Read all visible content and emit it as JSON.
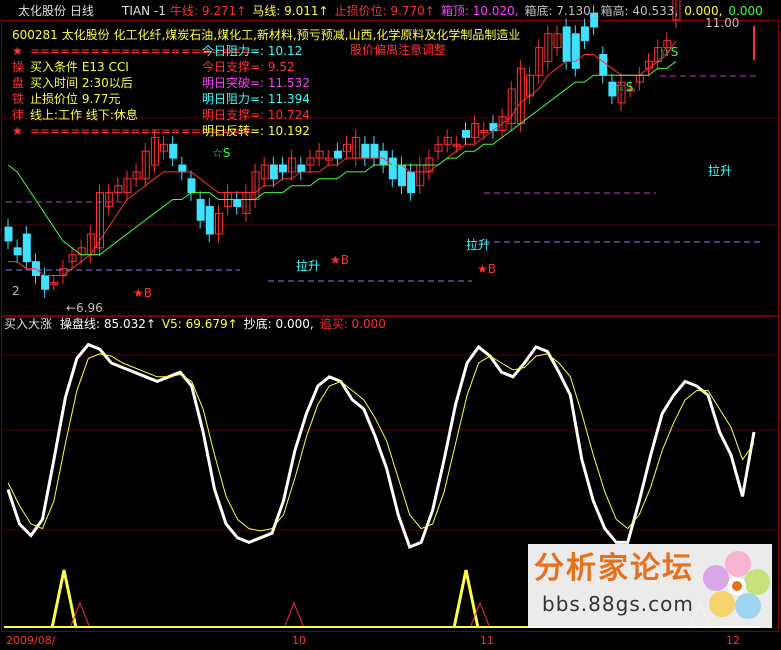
{
  "header": {
    "title": "太化股份 日线",
    "formula": "TIAN -1",
    "items": [
      {
        "label": "牛线:",
        "value": "9.271↑",
        "color": "#ff3030"
      },
      {
        "label": "马线:",
        "value": "9.011↑",
        "color": "#ffff40"
      },
      {
        "label": "止损价位:",
        "value": "9.770↑",
        "color": "#ff3030"
      },
      {
        "label": "箱顶:",
        "value": "10.020,",
        "color": "#ff40ff"
      },
      {
        "label": "箱底:",
        "value": "7.130,",
        "color": "#c0c0c0"
      },
      {
        "label": "箱高:",
        "value": "40.533,",
        "color": "#c0c0c0"
      },
      {
        "label": "",
        "value": "0.000,",
        "color": "#ffff40"
      },
      {
        "label": "",
        "value": "0.000",
        "color": "#40ff40"
      }
    ],
    "price_top": "11.00"
  },
  "info": {
    "stock_line": "600281 太化股份  化工化纤,煤炭石油,煤化工,新材料,预亏预减,山西,化学原料及化学制品制造业",
    "warning": "股价偏离注意调整",
    "rows_left": [
      {
        "mark": "★",
        "text": "======================"
      },
      {
        "mark": "操",
        "text": "买入条件     E13 CCI"
      },
      {
        "mark": "盘",
        "text": "买入时间     2:30以后"
      },
      {
        "mark": "铁",
        "text": "止损价位     9.77元"
      },
      {
        "mark": "律",
        "text": "线上:工作    线下:休息"
      },
      {
        "mark": "★",
        "text": "======================"
      }
    ],
    "rows_right": [
      {
        "text": "今日阻力=: 10.12",
        "color": "#40ffff"
      },
      {
        "text": "今日支撑=: 9.52",
        "color": "#ff3030"
      },
      {
        "text": "明日突破=: 11.532",
        "color": "#ff40ff"
      },
      {
        "text": "明日阻力=: 11.394",
        "color": "#40ffff"
      },
      {
        "text": "明日支撑=: 10.724",
        "color": "#ff3030"
      },
      {
        "text": "明日反转=: 10.192",
        "color": "#ffff40"
      }
    ]
  },
  "annotations": {
    "s1": "☆S",
    "s2": "☆S",
    "s3": "☆S",
    "b1": "★B",
    "b2": "★B",
    "b3": "★B",
    "l1": "拉升",
    "l2": "拉升",
    "l3": "拉升",
    "low": "←6.96",
    "two": "2"
  },
  "lower_header": {
    "title": "买入大涨",
    "items": [
      {
        "label": "操盘线:",
        "value": "85.032↑",
        "color": "#ffffff"
      },
      {
        "label": "V5:",
        "value": "69.679↑",
        "color": "#ffff40"
      },
      {
        "label": "抄底:",
        "value": "0.000,",
        "color": "#ffffff"
      },
      {
        "label": "追买:",
        "value": "0.000",
        "color": "#ff3030"
      }
    ]
  },
  "x_axis": {
    "labels": [
      "2009/08/",
      "10",
      "11",
      "12"
    ]
  },
  "watermark": {
    "title": "分析家论坛",
    "url": "bbs.88gs.com"
  },
  "colors": {
    "up": "#ff3030",
    "down": "#40e0ff",
    "ma1": "#ff3030",
    "ma2": "#40ff40",
    "osc": "#ffffff",
    "v5": "#ffff40"
  },
  "chart_data": [
    {
      "type": "candlestick",
      "x": [
        1,
        2,
        3,
        4,
        5,
        6,
        7,
        8,
        9,
        10,
        11,
        12,
        13,
        14,
        15,
        16,
        17,
        18,
        19,
        20,
        21,
        22,
        23,
        24,
        25,
        26,
        27,
        28,
        29,
        30,
        31,
        32,
        33,
        34,
        35,
        36,
        37,
        38,
        39,
        40,
        41,
        42,
        43,
        44,
        45,
        46,
        47,
        48,
        49,
        50,
        51,
        52,
        53,
        54,
        55,
        56,
        57,
        58,
        59,
        60,
        61,
        62,
        63,
        64,
        65,
        66,
        67,
        68,
        69,
        70,
        71,
        72,
        73,
        74,
        75,
        76,
        77,
        78,
        79,
        80,
        81
      ],
      "open": [
        8.0,
        7.7,
        7.9,
        7.5,
        7.3,
        7.2,
        7.3,
        7.5,
        7.6,
        7.6,
        7.7,
        8.3,
        8.5,
        8.5,
        8.7,
        8.7,
        8.9,
        9.1,
        9.2,
        8.9,
        8.7,
        8.4,
        8.3,
        7.9,
        8.3,
        8.4,
        8.2,
        8.4,
        8.7,
        8.9,
        8.9,
        8.8,
        8.9,
        8.9,
        9.0,
        9.0,
        9.1,
        9.1,
        9.0,
        9.2,
        9.2,
        9.1,
        9.0,
        8.9,
        8.8,
        8.6,
        8.8,
        9.1,
        9.2,
        9.2,
        9.4,
        9.3,
        9.4,
        9.5,
        9.4,
        9.5,
        9.5,
        9.9,
        10.2,
        10.4,
        10.6,
        10.9,
        10.8,
        10.9,
        11.1,
        10.5,
        10.1,
        9.8,
        10.0,
        10.1,
        10.3,
        10.4,
        10.6,
        11.0
      ],
      "close": [
        7.8,
        7.6,
        7.5,
        7.3,
        7.1,
        7.2,
        7.4,
        7.6,
        7.7,
        7.9,
        8.5,
        8.5,
        8.6,
        8.7,
        8.8,
        9.1,
        9.3,
        9.2,
        9.0,
        8.8,
        8.5,
        8.1,
        7.9,
        8.2,
        8.5,
        8.3,
        8.5,
        8.8,
        8.9,
        8.7,
        8.8,
        9.0,
        8.8,
        9.0,
        9.1,
        9.0,
        9.0,
        9.2,
        9.3,
        9.0,
        9.0,
        8.9,
        8.7,
        8.6,
        8.5,
        8.9,
        9.0,
        9.2,
        9.3,
        9.2,
        9.3,
        9.5,
        9.4,
        9.4,
        9.6,
        10.0,
        10.3,
        10.2,
        10.6,
        10.8,
        10.8,
        10.4,
        10.3,
        10.7,
        10.9,
        10.2,
        9.9,
        10.1,
        10.0,
        10.2,
        10.4,
        10.6,
        10.7,
        11.5
      ],
      "ma_red": [
        7.5,
        7.5,
        7.4,
        7.4,
        7.3,
        7.3,
        7.3,
        7.4,
        7.5,
        7.6,
        7.8,
        8.0,
        8.2,
        8.4,
        8.5,
        8.6,
        8.7,
        8.8,
        8.8,
        8.8,
        8.8,
        8.7,
        8.6,
        8.5,
        8.5,
        8.5,
        8.5,
        8.5,
        8.6,
        8.6,
        8.7,
        8.7,
        8.8,
        8.8,
        8.8,
        8.9,
        8.9,
        9.0,
        9.0,
        9.0,
        9.0,
        9.0,
        8.9,
        8.9,
        8.8,
        8.8,
        8.8,
        8.9,
        9.0,
        9.1,
        9.2,
        9.2,
        9.3,
        9.4,
        9.5,
        9.6,
        9.8,
        9.9,
        10.0,
        10.2,
        10.3,
        10.4,
        10.4,
        10.5,
        10.5,
        10.4,
        10.3,
        10.2,
        10.2,
        10.2,
        10.3,
        10.4,
        10.5,
        10.7
      ],
      "ma_green": [
        8.9,
        8.8,
        8.6,
        8.4,
        8.2,
        8.0,
        7.8,
        7.7,
        7.6,
        7.6,
        7.6,
        7.7,
        7.8,
        7.9,
        8.0,
        8.1,
        8.2,
        8.3,
        8.4,
        8.4,
        8.5,
        8.5,
        8.5,
        8.4,
        8.4,
        8.4,
        8.4,
        8.4,
        8.5,
        8.5,
        8.5,
        8.6,
        8.6,
        8.6,
        8.7,
        8.7,
        8.7,
        8.8,
        8.8,
        8.8,
        8.9,
        8.9,
        8.9,
        8.9,
        8.9,
        8.9,
        8.9,
        8.9,
        9.0,
        9.0,
        9.1,
        9.1,
        9.2,
        9.2,
        9.3,
        9.4,
        9.5,
        9.6,
        9.7,
        9.8,
        9.9,
        10.0,
        10.1,
        10.1,
        10.2,
        10.2,
        10.2,
        10.2,
        10.2,
        10.2,
        10.2,
        10.3,
        10.3,
        10.4
      ],
      "ylim": [
        6.8,
        11.0
      ]
    },
    {
      "type": "line",
      "series": [
        {
          "name": "操盘线",
          "values": [
            35,
            20,
            15,
            22,
            48,
            75,
            92,
            98,
            96,
            90,
            88,
            86,
            84,
            82,
            84,
            86,
            80,
            60,
            35,
            20,
            14,
            12,
            14,
            16,
            30,
            52,
            68,
            80,
            84,
            82,
            74,
            70,
            58,
            44,
            24,
            10,
            12,
            26,
            48,
            72,
            90,
            97,
            93,
            86,
            84,
            90,
            97,
            95,
            86,
            76,
            48,
            30,
            18,
            12,
            12,
            30,
            50,
            68,
            76,
            82,
            80,
            76,
            60,
            50,
            32,
            60
          ]
        },
        {
          "name": "V5",
          "values": [
            38,
            28,
            20,
            18,
            30,
            55,
            78,
            92,
            94,
            93,
            90,
            88,
            86,
            84,
            84,
            85,
            82,
            70,
            50,
            32,
            22,
            18,
            17,
            18,
            24,
            40,
            58,
            72,
            80,
            82,
            78,
            74,
            66,
            56,
            40,
            24,
            18,
            20,
            34,
            55,
            76,
            90,
            93,
            90,
            87,
            88,
            93,
            94,
            90,
            84,
            68,
            50,
            34,
            22,
            18,
            24,
            36,
            52,
            64,
            74,
            78,
            78,
            70,
            62,
            48,
            55
          ]
        }
      ],
      "ylim": [
        0,
        100
      ]
    }
  ]
}
